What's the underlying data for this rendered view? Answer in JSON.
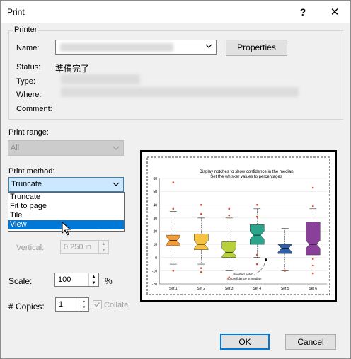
{
  "window": {
    "title": "Print",
    "help": "?",
    "close": "✕"
  },
  "printer": {
    "group_label": "Printer",
    "name_label": "Name:",
    "properties_label": "Properties",
    "status_label": "Status:",
    "status_value": "準備完了",
    "type_label": "Type:",
    "where_label": "Where:",
    "comment_label": "Comment:"
  },
  "print_range": {
    "label": "Print range:",
    "value": "All"
  },
  "print_method": {
    "label": "Print method:",
    "value": "Truncate",
    "options": [
      "Truncate",
      "Fit to page",
      "Tile",
      "View"
    ],
    "highlighted": "View"
  },
  "vertical": {
    "label": "Vertical:",
    "value": "0.250 in"
  },
  "scale": {
    "label": "Scale:",
    "value": "100",
    "unit": "%"
  },
  "copies": {
    "label": "# Copies:",
    "value": "1",
    "collate_label": "Collate",
    "collate_checked": true
  },
  "buttons": {
    "ok": "OK",
    "cancel": "Cancel"
  },
  "preview": {
    "chart_data": {
      "type": "boxplot",
      "title": "Display notches to show confidence in the median",
      "subtitle": "Set the whisker values to percentages",
      "annotation": "Inverted notch -\nno confidence in median",
      "ylim": [
        -20,
        60
      ],
      "yticks": [
        -20,
        -10,
        0,
        10,
        20,
        30,
        40,
        50,
        60
      ],
      "categories": [
        "Set 1",
        "Set 2",
        "Set 3",
        "Set 4",
        "Set 5",
        "Set 6"
      ],
      "colors": [
        "#f39c33",
        "#f5c242",
        "#b8d03a",
        "#2aa58c",
        "#2f5fa8",
        "#8a3f9a"
      ],
      "series": [
        {
          "name": "Set 1",
          "q1": 9,
          "median": 13,
          "q3": 17,
          "lo": -5,
          "hi": 35,
          "outliers": [
            57,
            37,
            -10
          ]
        },
        {
          "name": "Set 2",
          "q1": 6,
          "median": 10,
          "q3": 18,
          "lo": -5,
          "hi": 30,
          "outliers": [
            40,
            33,
            -8,
            -11
          ]
        },
        {
          "name": "Set 3",
          "q1": 0,
          "median": 4,
          "q3": 12,
          "lo": -10,
          "hi": 30,
          "outliers": [
            37,
            32,
            -15
          ]
        },
        {
          "name": "Set 4",
          "q1": 10,
          "median": 17,
          "q3": 25,
          "lo": 0,
          "hi": 37,
          "outliers": [
            40,
            31,
            2,
            -5
          ]
        },
        {
          "name": "Set 5",
          "q1": 3,
          "median": 7,
          "q3": 10,
          "lo": -10,
          "hi": 22,
          "outliers": [
            -10
          ]
        },
        {
          "name": "Set 6",
          "q1": 2,
          "median": 10,
          "q3": 27,
          "lo": -8,
          "hi": 37,
          "outliers": [
            53,
            39,
            -1,
            -6,
            -12
          ]
        }
      ]
    }
  }
}
